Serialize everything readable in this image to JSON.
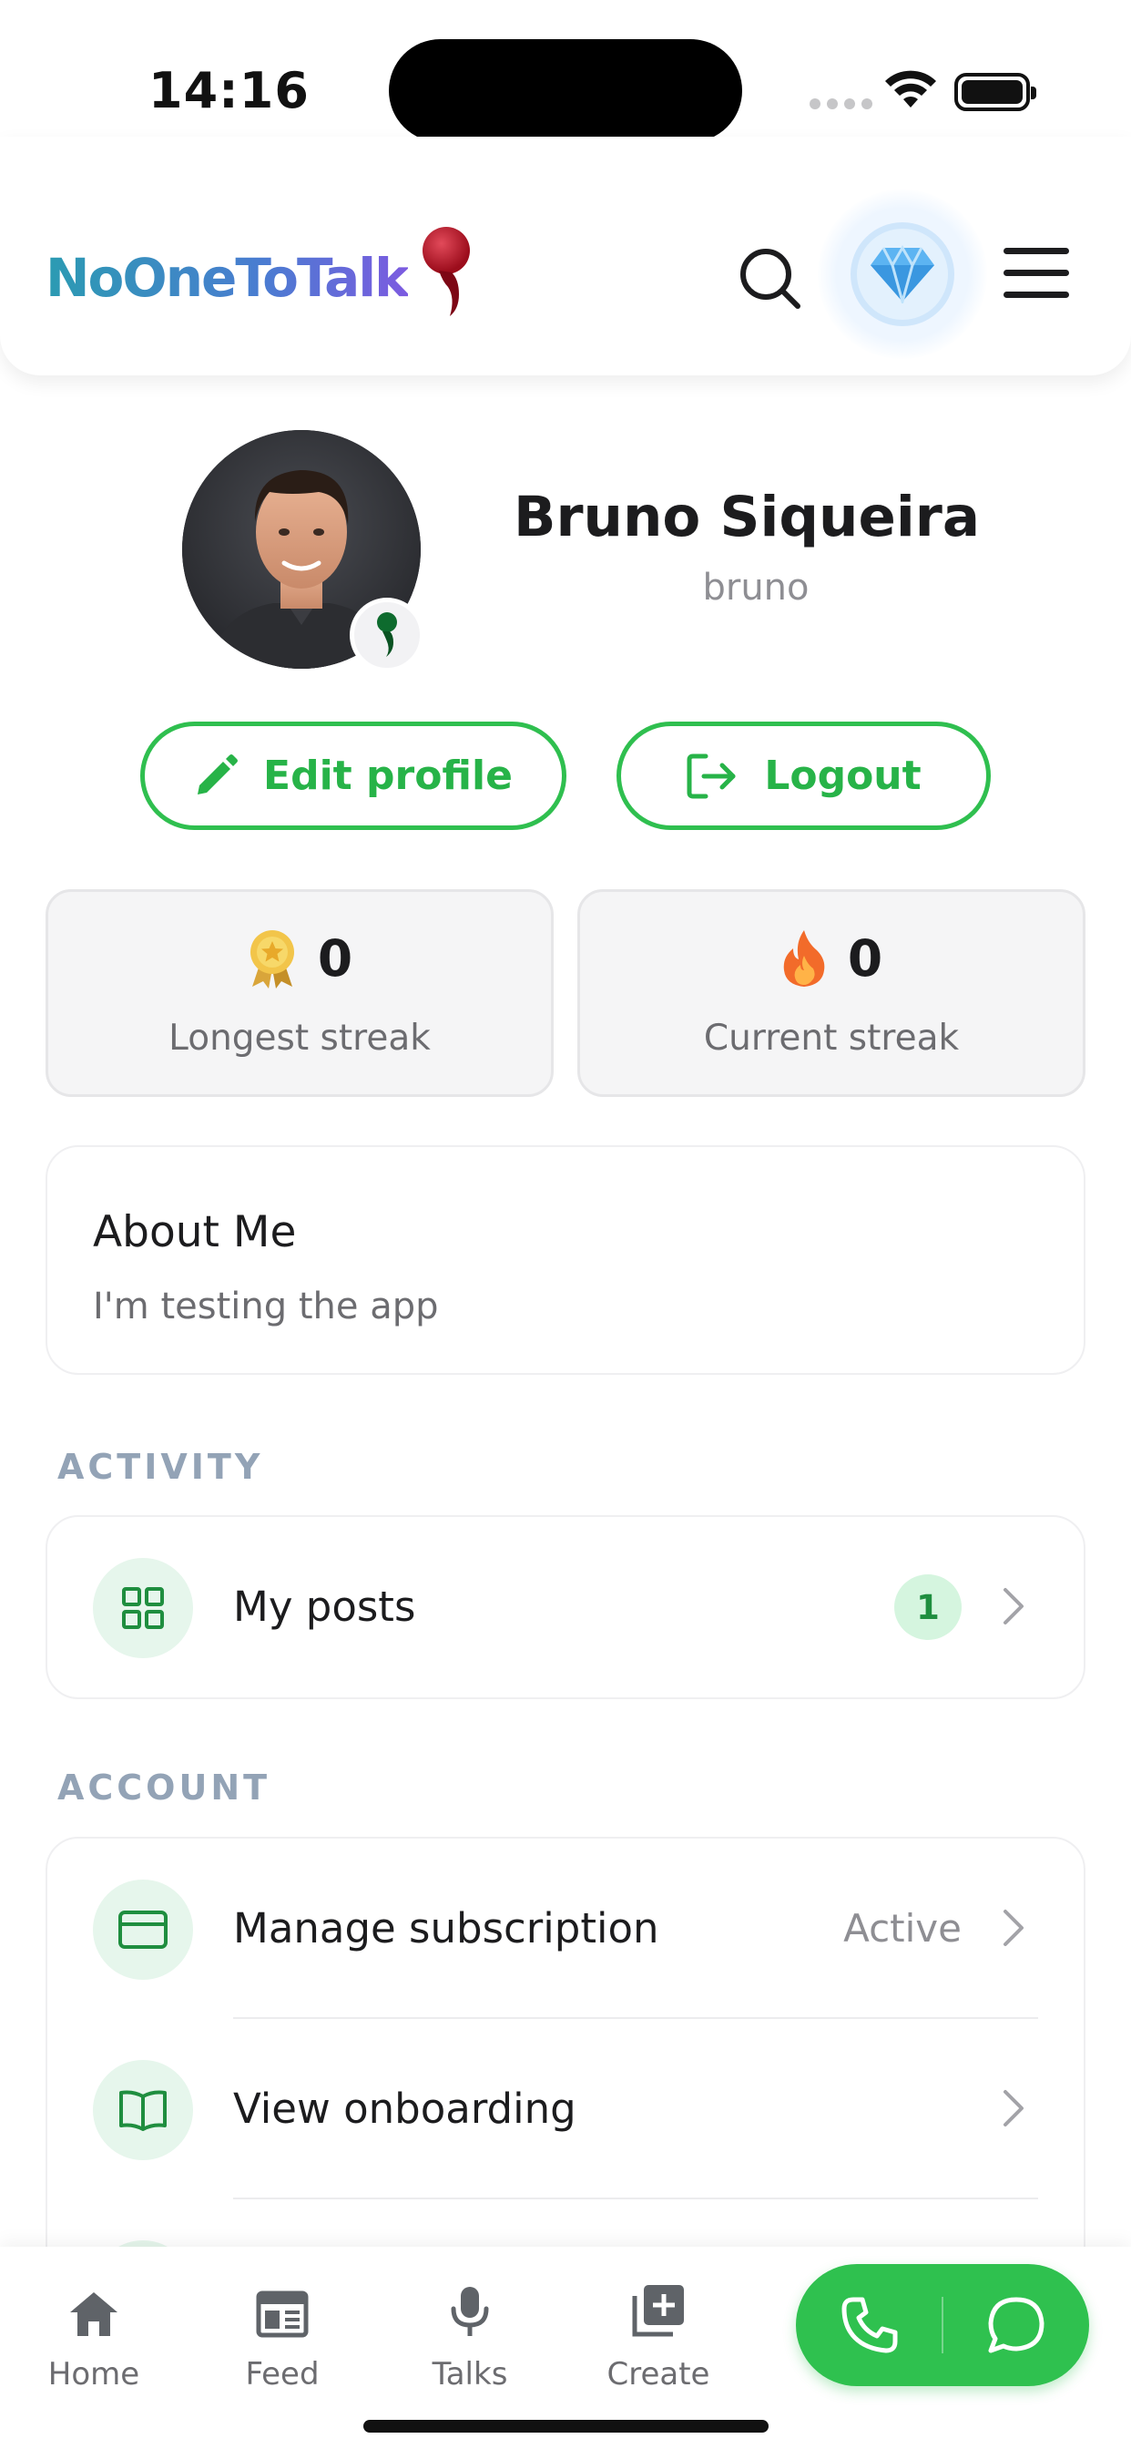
{
  "status_bar": {
    "time": "14:16"
  },
  "header": {
    "logo_text": "NoOneToTalk",
    "search_icon": "search-icon",
    "premium_icon": "diamond-icon",
    "menu_icon": "hamburger-menu-icon"
  },
  "profile": {
    "name": "Bruno Siqueira",
    "username": "bruno",
    "edit_label": "Edit profile",
    "logout_label": "Logout"
  },
  "stats": {
    "longest": {
      "value": "0",
      "label": "Longest streak",
      "icon": "medal-icon"
    },
    "current": {
      "value": "0",
      "label": "Current streak",
      "icon": "fire-icon"
    }
  },
  "about": {
    "title": "About Me",
    "text": "I'm testing the app"
  },
  "activity": {
    "title": "ACTIVITY",
    "items": [
      {
        "label": "My posts",
        "badge": "1",
        "icon": "grid-icon"
      }
    ]
  },
  "account": {
    "title": "ACCOUNT",
    "items": [
      {
        "label": "Manage subscription",
        "status": "Active",
        "icon": "credit-card-icon"
      },
      {
        "label": "View onboarding",
        "icon": "book-icon"
      }
    ]
  },
  "tabbar": {
    "items": [
      {
        "label": "Home",
        "icon": "home-icon"
      },
      {
        "label": "Feed",
        "icon": "newspaper-icon"
      },
      {
        "label": "Talks",
        "icon": "microphone-icon"
      },
      {
        "label": "Create",
        "icon": "add-box-icon"
      }
    ],
    "call_icon": "phone-icon",
    "chat_icon": "chat-bubble-icon"
  },
  "colors": {
    "accent_green": "#2fbf4f",
    "section_title": "#93a3b6",
    "badge_bg": "#d5f5df"
  }
}
